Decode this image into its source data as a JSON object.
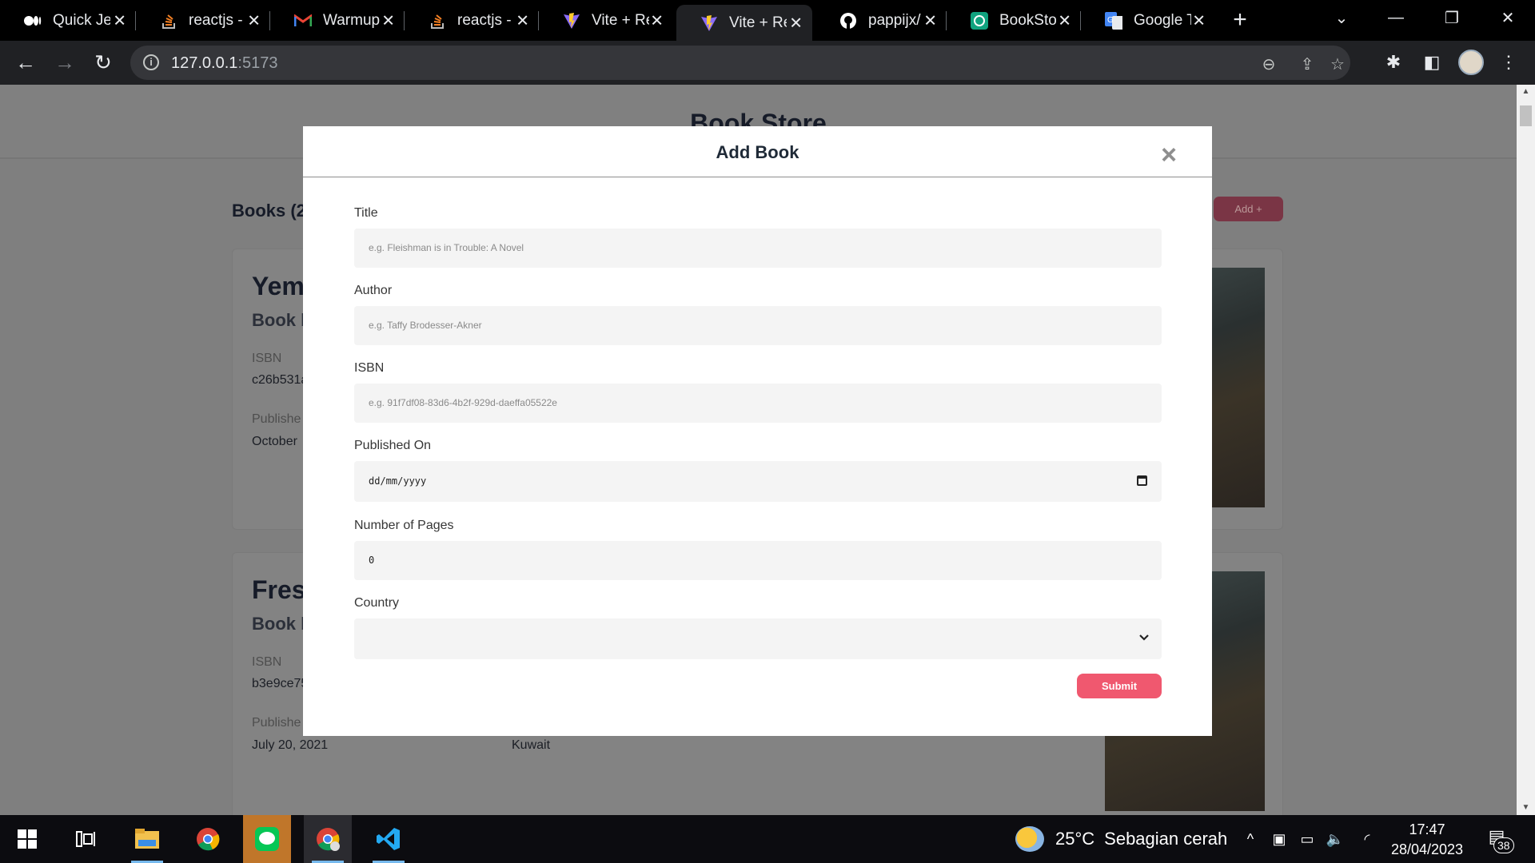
{
  "browser": {
    "tabs": [
      {
        "title": "Quick Jes",
        "icon": "medium-icon",
        "active": false
      },
      {
        "title": "reactjs - ",
        "icon": "stackoverflow-icon",
        "active": false
      },
      {
        "title": "Warmup",
        "icon": "gmail-icon",
        "active": false
      },
      {
        "title": "reactjs - ",
        "icon": "stackoverflow-icon",
        "active": false
      },
      {
        "title": "Vite + Re",
        "icon": "vite-icon",
        "active": false
      },
      {
        "title": "Vite + Re",
        "icon": "vite-icon",
        "active": true
      },
      {
        "title": "pappijx/",
        "icon": "github-icon",
        "active": false
      },
      {
        "title": "BookStor",
        "icon": "chatgpt-icon",
        "active": false
      },
      {
        "title": "Google T",
        "icon": "google-translate-icon",
        "active": false
      }
    ],
    "url_host": "127.0.0.1",
    "url_port": ":5173"
  },
  "page": {
    "header_title": "Book Store",
    "books_heading": "Books (2",
    "add_button": "Add +",
    "cards": [
      {
        "title": "Yem",
        "author": "Book b",
        "isbn_label": "ISBN",
        "isbn_value": "c26b531a",
        "published_label": "Publishe",
        "published_value": "October"
      },
      {
        "title": "Fres",
        "author": "Book b",
        "isbn_label": "ISBN",
        "isbn_value": "b3e9ce75",
        "published_label": "Publishe",
        "published_value": "July 20, 2021",
        "country_value": "Kuwait"
      }
    ]
  },
  "modal": {
    "title": "Add Book",
    "close": "×",
    "fields": {
      "title_label": "Title",
      "title_placeholder": "e.g. Fleishman is in Trouble: A Novel",
      "author_label": "Author",
      "author_placeholder": "e.g. Taffy Brodesser-Akner",
      "isbn_label": "ISBN",
      "isbn_placeholder": "e.g. 91f7df08-83d6-4b2f-929d-daeffa05522e",
      "published_label": "Published On",
      "published_value": "dd/mm/yyyy",
      "pages_label": "Number of Pages",
      "pages_value": "0",
      "country_label": "Country",
      "country_value": ""
    },
    "submit": "Submit"
  },
  "taskbar": {
    "weather_temp": "25°C",
    "weather_text": "Sebagian cerah",
    "time": "17:47",
    "date": "28/04/2023",
    "notifications": "38"
  },
  "colors": {
    "accent": "#f0586f",
    "modal_bg": "#ffffff",
    "input_bg": "#f4f4f4",
    "overlay": "#7f7f7f"
  }
}
